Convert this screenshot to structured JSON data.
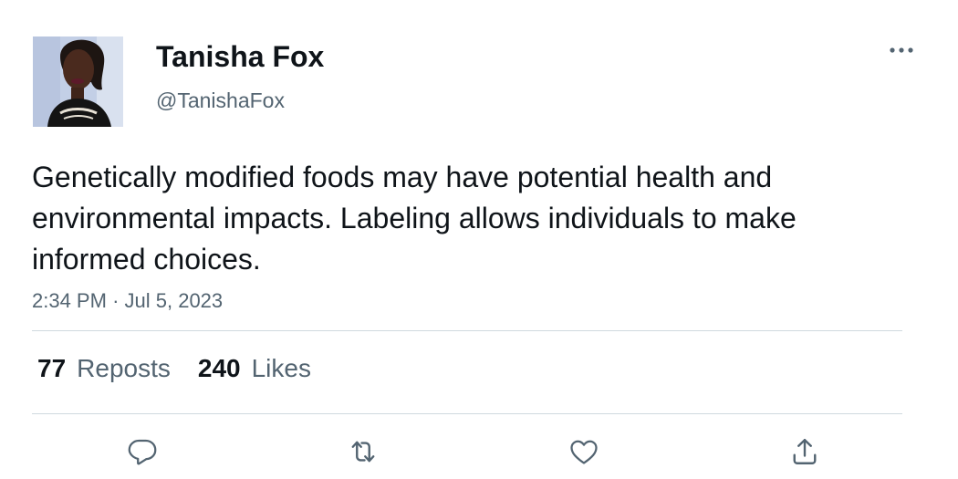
{
  "author": {
    "display_name": "Tanisha Fox",
    "handle": "@TanishaFox",
    "avatar_icon": "profile-photo"
  },
  "tweet": {
    "text": "Genetically modified foods may have potential health and environmental impacts. Labeling allows individuals to make informed choices.",
    "time": "2:34 PM",
    "separator": "·",
    "date": "Jul 5, 2023"
  },
  "stats": {
    "reposts_count": "77",
    "reposts_label": "Reposts",
    "likes_count": "240",
    "likes_label": "Likes"
  },
  "actions": {
    "reply_icon": "reply-icon",
    "repost_icon": "repost-icon",
    "like_icon": "heart-icon",
    "share_icon": "share-icon"
  },
  "colors": {
    "text_primary": "#0f1419",
    "text_secondary": "#536471",
    "divider": "#cfd9de"
  }
}
